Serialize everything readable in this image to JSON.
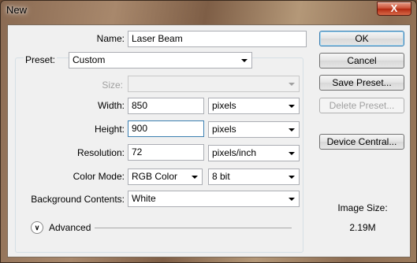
{
  "window": {
    "title": "New",
    "close_glyph": "X"
  },
  "form": {
    "name": {
      "label": "Name:",
      "value": "Laser Beam"
    },
    "preset": {
      "label": "Preset:",
      "value": "Custom"
    },
    "size": {
      "label": "Size:",
      "value": ""
    },
    "width": {
      "label": "Width:",
      "value": "850",
      "unit": "pixels"
    },
    "height": {
      "label": "Height:",
      "value": "900",
      "unit": "pixels"
    },
    "resolution": {
      "label": "Resolution:",
      "value": "72",
      "unit": "pixels/inch"
    },
    "color_mode": {
      "label": "Color Mode:",
      "value": "RGB Color",
      "depth": "8 bit"
    },
    "background": {
      "label": "Background Contents:",
      "value": "White"
    },
    "advanced": {
      "label": "Advanced"
    }
  },
  "buttons": {
    "ok": "OK",
    "cancel": "Cancel",
    "save_preset": "Save Preset...",
    "delete_preset": "Delete Preset...",
    "device_central": "Device Central..."
  },
  "image_size": {
    "label": "Image Size:",
    "value": "2.19M"
  }
}
